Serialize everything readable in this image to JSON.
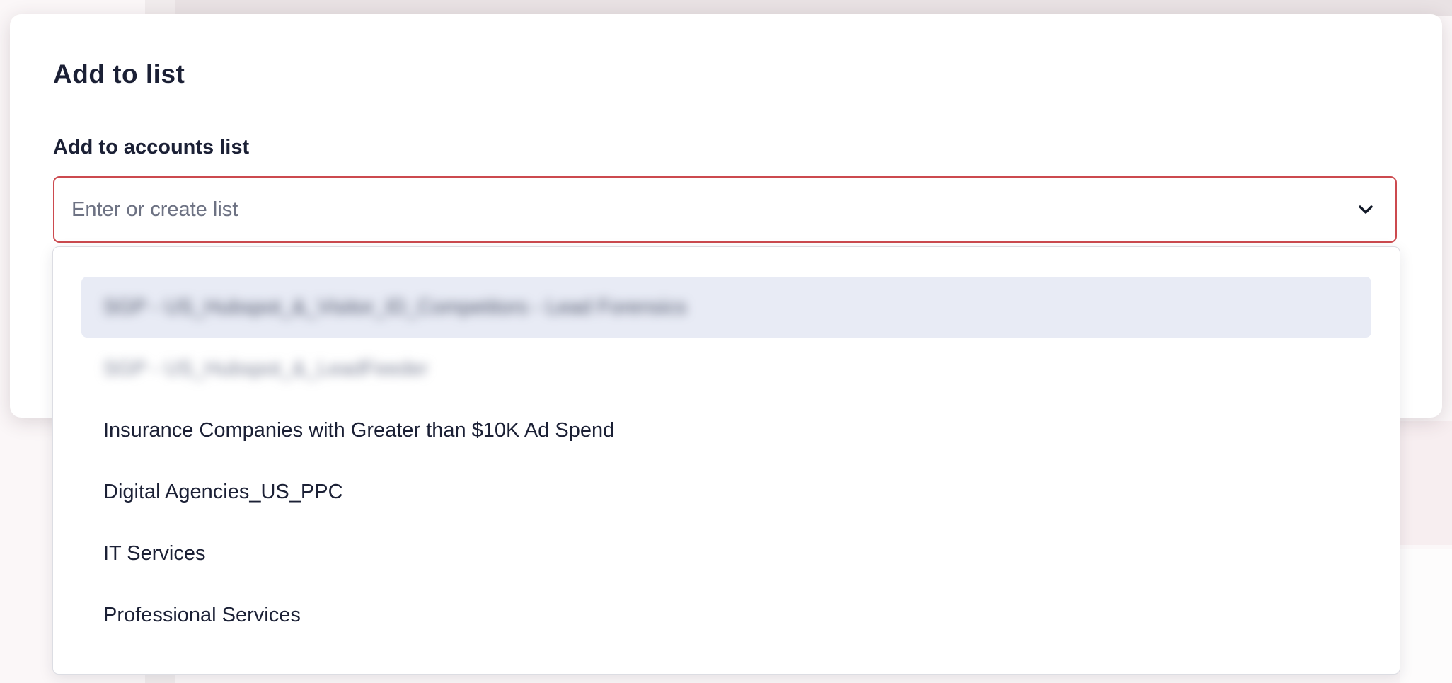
{
  "modal": {
    "title": "Add to list",
    "field_label": "Add to accounts list",
    "input": {
      "placeholder": "Enter or create list",
      "value": ""
    },
    "toggle_icon": "chevron-down-icon",
    "border_color": "#cc4a4f"
  },
  "dropdown": {
    "highlight_color": "#e8ebf5",
    "items": [
      {
        "label": "SGP - US_Hubspot_&_Visitor_ID_Competitors - Lead Forensics",
        "redacted": true,
        "highlighted": true
      },
      {
        "label": "SGP - US_Hubspot_&_LeadFeeder",
        "redacted": true,
        "highlighted": false
      },
      {
        "label": "Insurance Companies with Greater than $10K Ad Spend",
        "redacted": false,
        "highlighted": false
      },
      {
        "label": "Digital Agencies_US_PPC",
        "redacted": false,
        "highlighted": false
      },
      {
        "label": "IT Services",
        "redacted": false,
        "highlighted": false
      },
      {
        "label": "Professional Services",
        "redacted": false,
        "highlighted": false
      }
    ]
  }
}
